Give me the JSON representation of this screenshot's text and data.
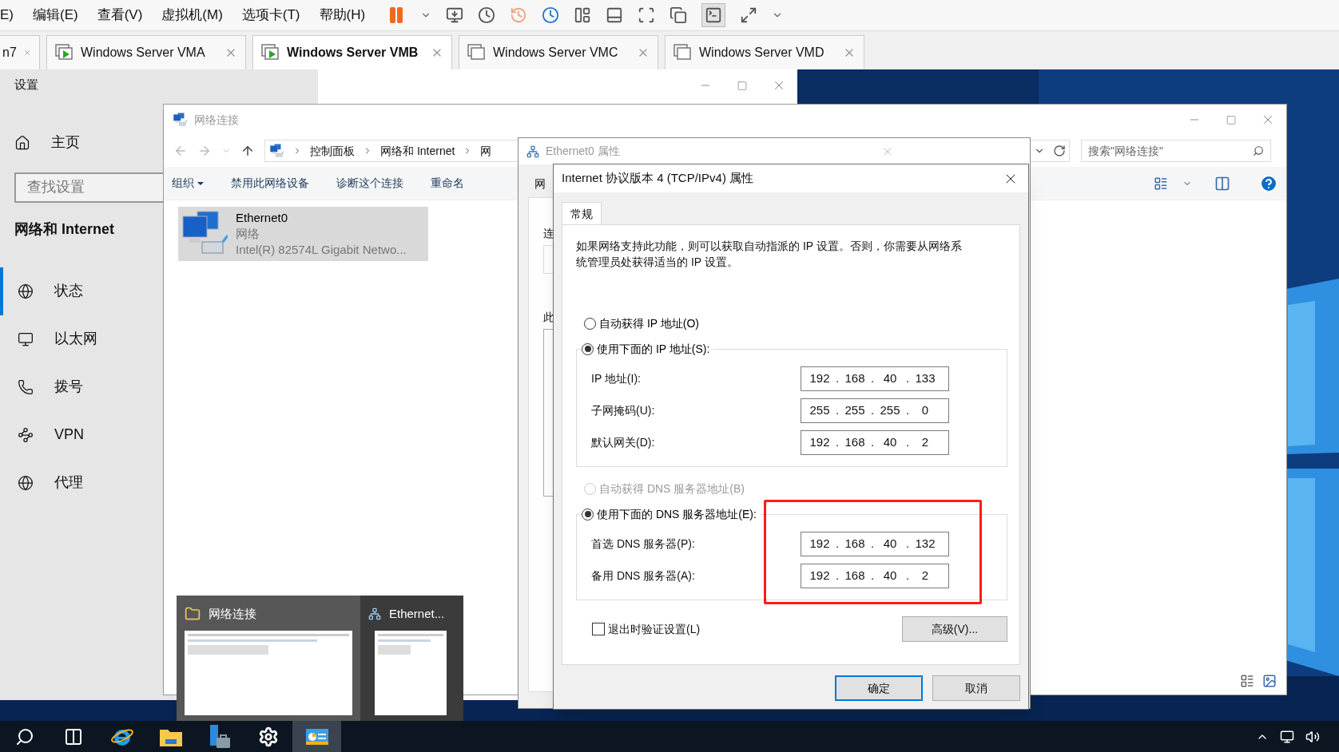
{
  "vm_menu": [
    "E)",
    "编辑(E)",
    "查看(V)",
    "虚拟机(M)",
    "选项卡(T)",
    "帮助(H)"
  ],
  "vm_tabs": [
    {
      "label": "n7",
      "selected": false
    },
    {
      "label": "Windows Server VMA",
      "selected": false,
      "running": true
    },
    {
      "label": "Windows Server VMB",
      "selected": true,
      "running": true
    },
    {
      "label": "Windows Server VMC",
      "selected": false,
      "running": false
    },
    {
      "label": "Windows Server VMD",
      "selected": false,
      "running": false
    }
  ],
  "settings": {
    "title": "设置",
    "home": "主页",
    "search_placeholder": "查找设置",
    "section": "网络和 Internet",
    "nav": [
      {
        "label": "状态",
        "selected": true
      },
      {
        "label": "以太网",
        "selected": false
      },
      {
        "label": "拨号",
        "selected": false
      },
      {
        "label": "VPN",
        "selected": false
      },
      {
        "label": "代理",
        "selected": false
      }
    ]
  },
  "explorer": {
    "title": "网络连接",
    "breadcrumbs": [
      "控制面板",
      "网络和 Internet",
      "网"
    ],
    "search_placeholder": "搜索\"网络连接\"",
    "commands": [
      {
        "label": "组织",
        "menu": true
      },
      {
        "label": "禁用此网络设备",
        "menu": false
      },
      {
        "label": "诊断这个连接",
        "menu": false
      },
      {
        "label": "重命名",
        "menu": false
      }
    ],
    "items": [
      {
        "name": "Ethernet0",
        "type": "网络",
        "device": "Intel(R) 82574L Gigabit Netwo...",
        "selected": true
      }
    ]
  },
  "properties_window": {
    "title": "Ethernet0 属性",
    "tab": "网",
    "label_1": "连",
    "label_2": "此"
  },
  "ipv4_dialog": {
    "title": "Internet 协议版本 4 (TCP/IPv4) 属性",
    "tabs": [
      {
        "label": "常规",
        "selected": true
      }
    ],
    "description": "如果网络支持此功能，则可以获取自动指派的 IP 设置。否则，你需要从网络系统管理员处获得适当的 IP 设置。",
    "separator": ".",
    "ip_options": [
      {
        "label": "自动获得 IP 地址(O)",
        "selected": false,
        "disabled": false
      },
      {
        "label": "使用下面的 IP 地址(S):",
        "selected": true,
        "disabled": false
      }
    ],
    "ip_fields": [
      {
        "label": "IP 地址(I):",
        "octets": [
          "192",
          "168",
          "40",
          "133"
        ]
      },
      {
        "label": "子网掩码(U):",
        "octets": [
          "255",
          "255",
          "255",
          "0"
        ]
      },
      {
        "label": "默认网关(D):",
        "octets": [
          "192",
          "168",
          "40",
          "2"
        ]
      }
    ],
    "dns_options": [
      {
        "label": "自动获得 DNS 服务器地址(B)",
        "selected": false,
        "disabled": true
      },
      {
        "label": "使用下面的 DNS 服务器地址(E):",
        "selected": true,
        "disabled": false
      }
    ],
    "dns_fields": [
      {
        "label": "首选 DNS 服务器(P):",
        "octets": [
          "192",
          "168",
          "40",
          "132"
        ]
      },
      {
        "label": "备用 DNS 服务器(A):",
        "octets": [
          "192",
          "168",
          "40",
          "2"
        ]
      }
    ],
    "validate": {
      "label": "退出时验证设置(L)",
      "checked": false
    },
    "advanced": "高级(V)...",
    "buttons": [
      {
        "label": "确定",
        "default": true
      },
      {
        "label": "取消",
        "default": false
      }
    ]
  },
  "previews": [
    {
      "title": "网络连接",
      "hovered": true
    },
    {
      "title": "Ethernet...",
      "hovered": false
    }
  ],
  "taskbar": [
    {
      "kind": "search",
      "active": false
    },
    {
      "kind": "task-view",
      "active": false
    },
    {
      "kind": "browser",
      "active": false
    },
    {
      "kind": "files",
      "active": false
    },
    {
      "kind": "server",
      "active": false
    },
    {
      "kind": "settings",
      "active": false
    },
    {
      "kind": "control-panel",
      "active": true
    }
  ]
}
